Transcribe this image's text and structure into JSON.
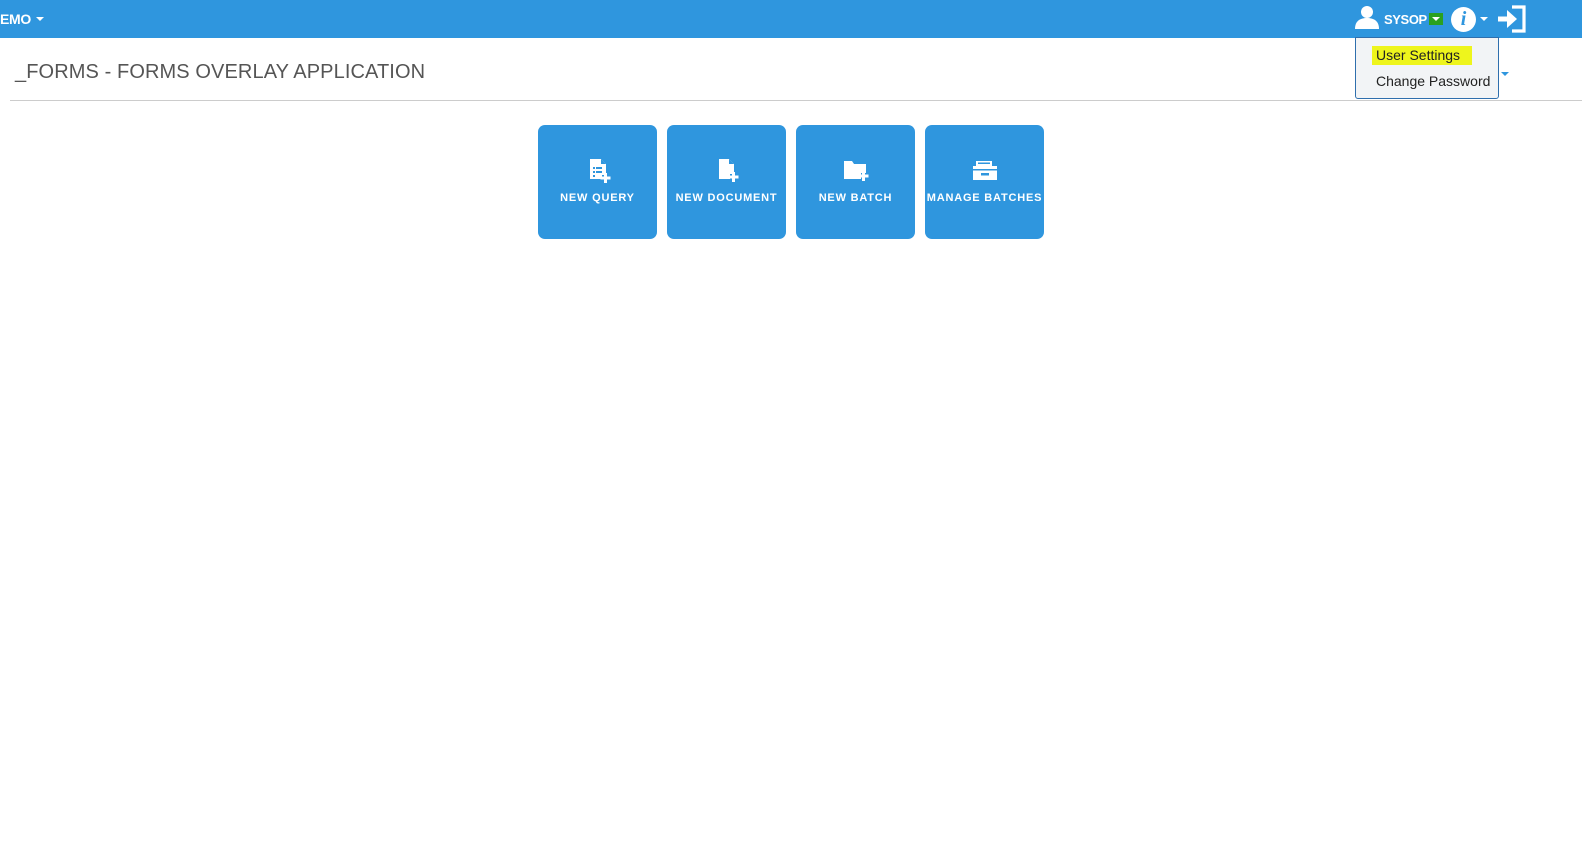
{
  "topbar": {
    "env_label": "EMO",
    "user_name": "SYSOP",
    "info_glyph": "i",
    "icons": {
      "user": "user-icon",
      "info": "info-icon",
      "logout": "logout-icon"
    }
  },
  "user_menu": {
    "items": [
      {
        "label": "User Settings",
        "highlighted": true
      },
      {
        "label": "Change Password",
        "highlighted": false
      }
    ]
  },
  "page": {
    "title": "_FORMS - FORMS OVERLAY APPLICATION"
  },
  "tiles": [
    {
      "label": "NEW QUERY",
      "icon": "new-query-icon"
    },
    {
      "label": "NEW DOCUMENT",
      "icon": "new-document-icon"
    },
    {
      "label": "NEW BATCH",
      "icon": "new-batch-icon"
    },
    {
      "label": "MANAGE BATCHES",
      "icon": "manage-batches-icon"
    }
  ],
  "colors": {
    "accent": "#2f96de",
    "highlight": "#eef51c",
    "user_caret_bg": "#2aa11f"
  }
}
